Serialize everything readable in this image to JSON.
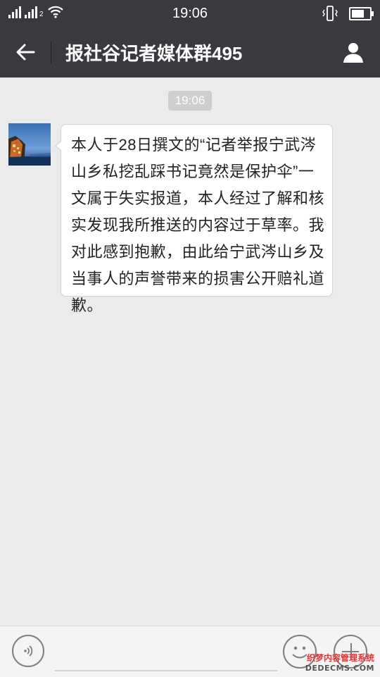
{
  "status_bar": {
    "time": "19:06",
    "sim2_label": "2",
    "icons": [
      "signal-icon",
      "signal-icon",
      "wifi-icon",
      "vibrate-icon",
      "battery-icon"
    ]
  },
  "header": {
    "title": "报社谷记者媒体群495",
    "back_icon": "back-arrow-icon",
    "profile_icon": "person-icon",
    "bg_color": "#393a3f"
  },
  "chat": {
    "timestamp": "19:06",
    "messages": [
      {
        "text": "本人于28日撰文的“记者举报宁武涔山乡私挖乱踩书记竟然是保护伞”一文属于失实报道，本人经过了解和核实发现我所推送的内容过于草率。我对此感到抱歉，由此给宁武涔山乡及当事人的声誉带来的损害公开赔礼道歉。"
      }
    ]
  },
  "input_bar": {
    "value": "",
    "voice_icon": "voice-icon",
    "emoji_icon": "emoji-icon",
    "more_icon": "plus-icon"
  },
  "watermark": {
    "line1": "织梦内容管理系统",
    "line2": "DEDECMS.COM"
  }
}
